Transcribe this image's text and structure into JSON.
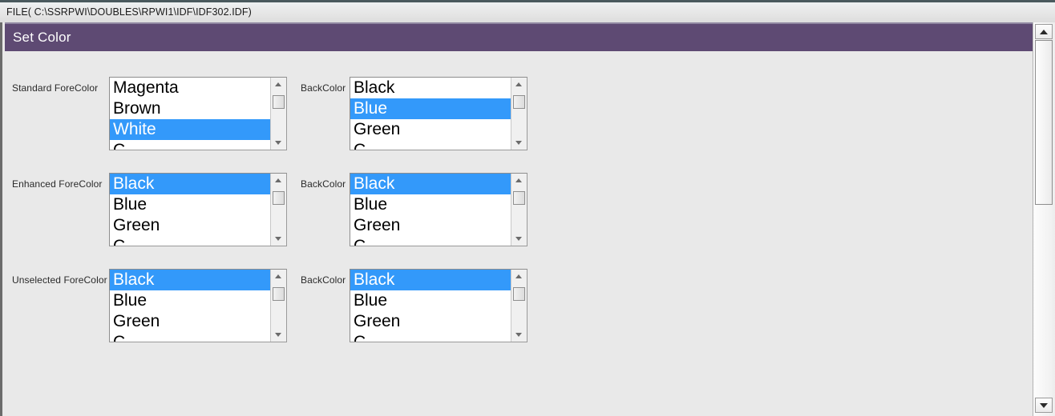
{
  "filebar": {
    "path": "FILE( C:\\SSRPWI\\DOUBLES\\RPWI1\\IDF\\IDF302.IDF)"
  },
  "window": {
    "title": "Set Color",
    "accent_color": "#5e4a73",
    "selection_color": "#3399fa",
    "background_color": "#e9e9e9"
  },
  "rows": [
    {
      "fore_label": "Standard ForeColor",
      "back_label": "BackColor",
      "fore_items": [
        "Magenta",
        "Brown",
        "White",
        "C"
      ],
      "fore_selected": "White",
      "back_items": [
        "Black",
        "Blue",
        "Green",
        "C"
      ],
      "back_selected": "Blue"
    },
    {
      "fore_label": "Enhanced ForeColor",
      "back_label": "BackColor",
      "fore_items": [
        "Black",
        "Blue",
        "Green",
        "C"
      ],
      "fore_selected": "Black",
      "back_items": [
        "Black",
        "Blue",
        "Green",
        "C"
      ],
      "back_selected": "Black"
    },
    {
      "fore_label": "Unselected ForeColor",
      "back_label": "BackColor",
      "fore_items": [
        "Black",
        "Blue",
        "Green",
        "C"
      ],
      "fore_selected": "Black",
      "back_items": [
        "Black",
        "Blue",
        "Green",
        "C"
      ],
      "back_selected": "Black"
    }
  ],
  "scrollbar": {
    "up_arrow": "scroll-up-icon",
    "down_arrow": "scroll-down-icon"
  }
}
